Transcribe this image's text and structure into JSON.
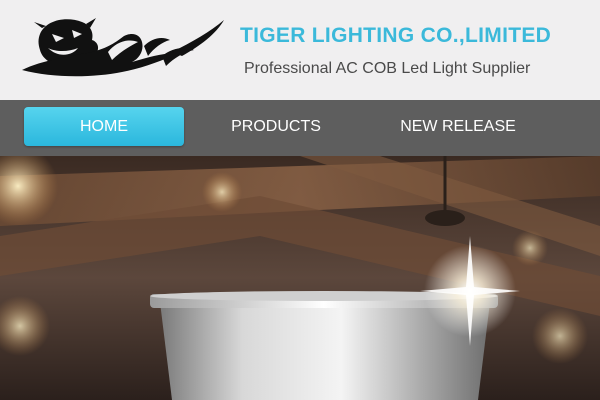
{
  "header": {
    "company_name": "TIGER LIGHTING CO.,LIMITED",
    "tagline": "Professional AC COB Led Light Supplier",
    "logo_icon": "tiger-logo"
  },
  "nav": {
    "items": [
      {
        "label": "HOME",
        "active": true
      },
      {
        "label": "PRODUCTS",
        "active": false
      },
      {
        "label": "NEW RELEASE",
        "active": false
      }
    ]
  },
  "hero": {
    "image": "led-downlight-ceiling-banner"
  },
  "colors": {
    "accent": "#3bb9da",
    "nav_bg": "#5e5e5e",
    "header_bg": "#f0eff0"
  }
}
